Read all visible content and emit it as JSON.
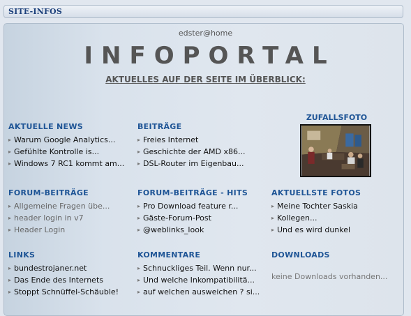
{
  "header": {
    "title": "SITE-INFOS"
  },
  "user": "edster@home",
  "logo": "INFOPORTAL",
  "subtitle": "AKTUELLES AUF DER SEITE IM ÜBERBLICK:",
  "photo": {
    "title": "ZUFALLSFOTO"
  },
  "sections": {
    "news": {
      "title": "AKTUELLE NEWS",
      "items": [
        "Warum Google Analytics...",
        "Gefühlte Kontrolle is...",
        "Windows 7 RC1 kommt am..."
      ]
    },
    "beitraege": {
      "title": "BEITRÄGE",
      "items": [
        "Freies Internet",
        "Geschichte der AMD x86...",
        "DSL-Router im Eigenbau..."
      ]
    },
    "forum": {
      "title": "FORUM-BEITRÄGE",
      "items": [
        "Allgemeine Fragen übe...",
        "header login in v7",
        "Header Login"
      ]
    },
    "forum_hits": {
      "title": "FORUM-BEITRÄGE - HITS",
      "items": [
        "Pro Download feature r...",
        "Gäste-Forum-Post",
        "@weblinks_look"
      ]
    },
    "fotos": {
      "title": "AKTUELLSTE FOTOS",
      "items": [
        "Meine Tochter Saskia",
        "Kollegen...",
        "Und es wird dunkel"
      ]
    },
    "links": {
      "title": "LINKS",
      "items": [
        "bundestrojaner.net",
        "Das Ende des Internets",
        "Stoppt Schnüffel-Schäuble!"
      ]
    },
    "kommentare": {
      "title": "KOMMENTARE",
      "items": [
        "Schnuckliges Teil. Wenn nur...",
        "Und welche Inkompatibilitä...",
        "auf welchen ausweichen ? si..."
      ]
    },
    "downloads": {
      "title": "DOWNLOADS",
      "note": "keine Downloads vorhanden..."
    }
  },
  "colors": {
    "accent": "#1f5596",
    "header_text": "#1b3f7a",
    "logo": "#555555"
  }
}
